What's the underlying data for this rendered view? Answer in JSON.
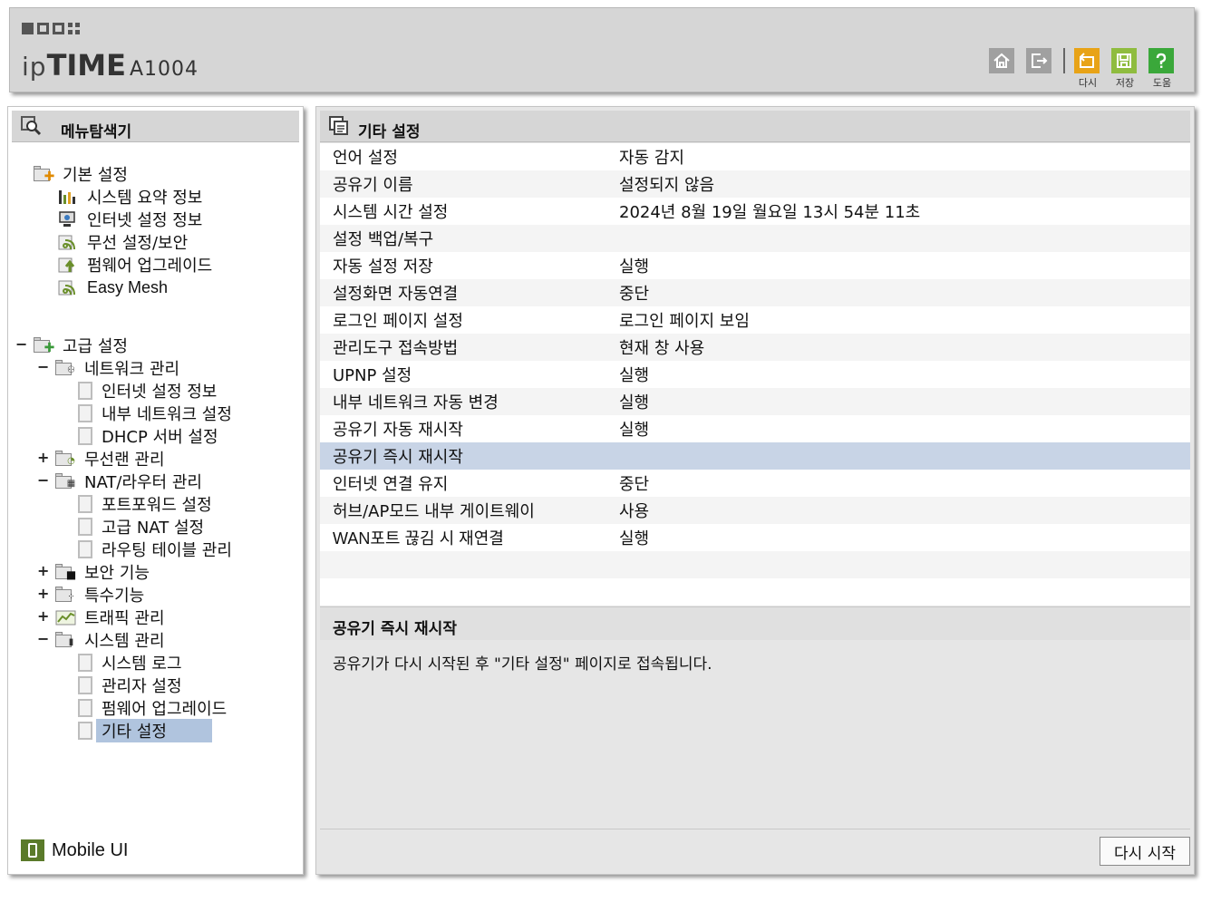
{
  "header": {
    "brand_prefix": "ip",
    "brand_main": "TIME",
    "model": "A1004",
    "icons": {
      "home": "home-icon",
      "logout": "logout-icon",
      "retry": "retry-icon",
      "save": "save-icon",
      "help": "help-icon"
    },
    "retry_label": "다시",
    "save_label": "저장",
    "help_label": "도움",
    "colors": {
      "retry": "#e8a317",
      "save": "#8fbc3f",
      "help": "#3aa83a",
      "gray_btn": "#a0a0a0"
    }
  },
  "sidebar": {
    "title": "메뉴탐색기",
    "basic": {
      "label": "기본 설정",
      "items": [
        "시스템 요약 정보",
        "인터넷 설정 정보",
        "무선 설정/보안",
        "펌웨어 업그레이드",
        "Easy Mesh"
      ]
    },
    "advanced": {
      "label": "고급 설정",
      "toggle": "−",
      "network": {
        "label": "네트워크 관리",
        "toggle": "−",
        "items": [
          "인터넷 설정 정보",
          "내부 네트워크 설정",
          "DHCP 서버 설정"
        ]
      },
      "wireless": {
        "label": "무선랜 관리",
        "toggle": "+"
      },
      "nat": {
        "label": "NAT/라우터 관리",
        "toggle": "−",
        "items": [
          "포트포워드 설정",
          "고급 NAT 설정",
          "라우팅 테이블 관리"
        ]
      },
      "security": {
        "label": "보안 기능",
        "toggle": "+"
      },
      "special": {
        "label": "특수기능",
        "toggle": "+"
      },
      "traffic": {
        "label": "트래픽 관리",
        "toggle": "+"
      },
      "system": {
        "label": "시스템 관리",
        "toggle": "−",
        "items": [
          "시스템 로그",
          "관리자 설정",
          "펌웨어 업그레이드",
          "기타 설정"
        ]
      }
    },
    "mobile_ui": "Mobile UI"
  },
  "main": {
    "title": "기타 설정",
    "rows": [
      {
        "label": "언어 설정",
        "value": "자동 감지"
      },
      {
        "label": "공유기 이름",
        "value": "설정되지 않음"
      },
      {
        "label": "시스템 시간 설정",
        "value": "2024년 8월 19일 월요일 13시 54분 11초"
      },
      {
        "label": "설정 백업/복구",
        "value": ""
      },
      {
        "label": "자동 설정 저장",
        "value": "실행"
      },
      {
        "label": "설정화면 자동연결",
        "value": "중단"
      },
      {
        "label": "로그인 페이지 설정",
        "value": "로그인 페이지 보임"
      },
      {
        "label": "관리도구 접속방법",
        "value": "현재 창 사용"
      },
      {
        "label": "UPNP 설정",
        "value": "실행"
      },
      {
        "label": "내부 네트워크 자동 변경",
        "value": "실행"
      },
      {
        "label": "공유기 자동 재시작",
        "value": "실행"
      },
      {
        "label": "공유기 즉시 재시작",
        "value": ""
      },
      {
        "label": "인터넷 연결 유지",
        "value": "중단"
      },
      {
        "label": "허브/AP모드 내부 게이트웨이",
        "value": "사용"
      },
      {
        "label": "WAN포트 끊김 시 재연결",
        "value": "실행"
      },
      {
        "label": "",
        "value": ""
      },
      {
        "label": "",
        "value": ""
      }
    ],
    "section_title": "공유기 즉시 재시작",
    "description": "공유기가 다시 시작된 후 \"기타 설정\" 페이지로 접속됩니다.",
    "restart_button": "다시 시작",
    "highlight_color": "#c8d4e6"
  }
}
